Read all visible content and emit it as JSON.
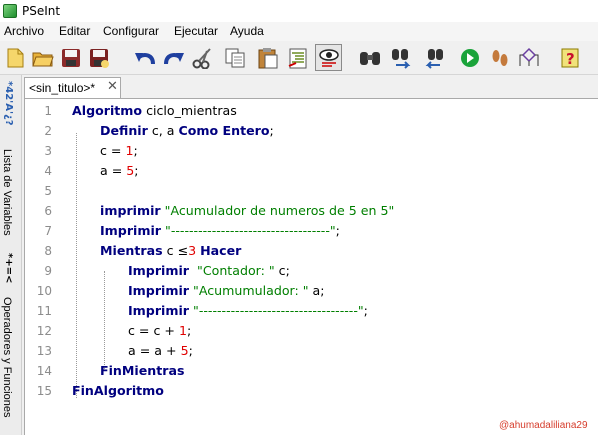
{
  "window": {
    "title": "PSeInt",
    "logo": "pseint-logo"
  },
  "menu": [
    "Archivo",
    "Editar",
    "Configurar",
    "Ejecutar",
    "Ayuda"
  ],
  "toolbar": [
    {
      "name": "new-file-icon",
      "color": "#f2c94c"
    },
    {
      "name": "open-folder-icon",
      "color": "#e8b23a"
    },
    {
      "name": "save-icon",
      "color": "#8b2a2a"
    },
    {
      "name": "save-as-icon",
      "color": "#8b2a2a"
    },
    {
      "name": "undo-icon",
      "color": "#1f3f9f"
    },
    {
      "name": "redo-icon",
      "color": "#1f3f9f"
    },
    {
      "name": "cut-icon",
      "color": "#555555"
    },
    {
      "name": "copy-icon",
      "color": "#777777"
    },
    {
      "name": "paste-icon",
      "color": "#c0843a"
    },
    {
      "name": "indent-icon",
      "color": "#6b8e23"
    },
    {
      "name": "preview-icon",
      "color": "#333333"
    },
    {
      "name": "find-icon",
      "color": "#333333"
    },
    {
      "name": "find-replace-icon",
      "color": "#2a5fb0"
    },
    {
      "name": "replace-icon",
      "color": "#2a5fb0"
    },
    {
      "name": "run-icon",
      "color": "#1aa33a"
    },
    {
      "name": "step-icon",
      "color": "#c47a3c"
    },
    {
      "name": "flowchart-icon",
      "color": "#6a3fa0"
    },
    {
      "name": "help-icon",
      "color": "#c8102e"
    }
  ],
  "side_panel": {
    "variables_icon": "*42'A'¿?",
    "variables_label": "Lista de Variables",
    "operators_icon": "*+=<",
    "operators_label": "Operadores y Funciones"
  },
  "tab": {
    "label": "<sin_titulo>*",
    "close": "✕"
  },
  "editor": {
    "lines": [
      {
        "n": "1",
        "indent": 0,
        "tokens": [
          {
            "t": "Algoritmo",
            "c": "kw"
          },
          {
            "t": " ciclo_mientras",
            "c": "op"
          }
        ]
      },
      {
        "n": "2",
        "indent": 1,
        "tokens": [
          {
            "t": "Definir",
            "c": "kw"
          },
          {
            "t": " c, a ",
            "c": "op"
          },
          {
            "t": "Como Entero",
            "c": "kw"
          },
          {
            "t": ";",
            "c": "op"
          }
        ]
      },
      {
        "n": "3",
        "indent": 1,
        "tokens": [
          {
            "t": "c = ",
            "c": "op"
          },
          {
            "t": "1",
            "c": "num"
          },
          {
            "t": ";",
            "c": "op"
          }
        ]
      },
      {
        "n": "4",
        "indent": 1,
        "tokens": [
          {
            "t": "a = ",
            "c": "op"
          },
          {
            "t": "5",
            "c": "num"
          },
          {
            "t": ";",
            "c": "op"
          }
        ]
      },
      {
        "n": "5",
        "indent": 0,
        "tokens": []
      },
      {
        "n": "6",
        "indent": 1,
        "tokens": [
          {
            "t": "imprimir",
            "c": "kw"
          },
          {
            "t": " ",
            "c": "op"
          },
          {
            "t": "\"Acumulador de numeros de 5 en 5\"",
            "c": "str"
          }
        ]
      },
      {
        "n": "7",
        "indent": 1,
        "tokens": [
          {
            "t": "Imprimir",
            "c": "kw"
          },
          {
            "t": " ",
            "c": "op"
          },
          {
            "t": "\"-----------------------------------\"",
            "c": "str"
          },
          {
            "t": ";",
            "c": "op"
          }
        ]
      },
      {
        "n": "8",
        "indent": 1,
        "tokens": [
          {
            "t": "Mientras",
            "c": "kw"
          },
          {
            "t": " c ≤",
            "c": "op"
          },
          {
            "t": "3",
            "c": "num"
          },
          {
            "t": " ",
            "c": "op"
          },
          {
            "t": "Hacer",
            "c": "kw"
          }
        ]
      },
      {
        "n": "9",
        "indent": 2,
        "tokens": [
          {
            "t": "Imprimir",
            "c": "kw"
          },
          {
            "t": "  ",
            "c": "op"
          },
          {
            "t": "\"Contador: \"",
            "c": "str"
          },
          {
            "t": " c;",
            "c": "op"
          }
        ]
      },
      {
        "n": "10",
        "indent": 2,
        "tokens": [
          {
            "t": "Imprimir",
            "c": "kw"
          },
          {
            "t": " ",
            "c": "op"
          },
          {
            "t": "\"Acumumulador: \"",
            "c": "str"
          },
          {
            "t": " a;",
            "c": "op"
          }
        ]
      },
      {
        "n": "11",
        "indent": 2,
        "tokens": [
          {
            "t": "Imprimir",
            "c": "kw"
          },
          {
            "t": " ",
            "c": "op"
          },
          {
            "t": "\"-----------------------------------\"",
            "c": "str"
          },
          {
            "t": ";",
            "c": "op"
          }
        ]
      },
      {
        "n": "12",
        "indent": 2,
        "tokens": [
          {
            "t": "c = c + ",
            "c": "op"
          },
          {
            "t": "1",
            "c": "num"
          },
          {
            "t": ";",
            "c": "op"
          }
        ]
      },
      {
        "n": "13",
        "indent": 2,
        "tokens": [
          {
            "t": "a = a + ",
            "c": "op"
          },
          {
            "t": "5",
            "c": "num"
          },
          {
            "t": ";",
            "c": "op"
          }
        ]
      },
      {
        "n": "14",
        "indent": 1,
        "tokens": [
          {
            "t": "FinMientras",
            "c": "kw"
          }
        ]
      },
      {
        "n": "15",
        "indent": 0,
        "tokens": [
          {
            "t": "FinAlgoritmo",
            "c": "kw"
          }
        ]
      }
    ]
  },
  "watermark": "@ahumadaliliana29"
}
